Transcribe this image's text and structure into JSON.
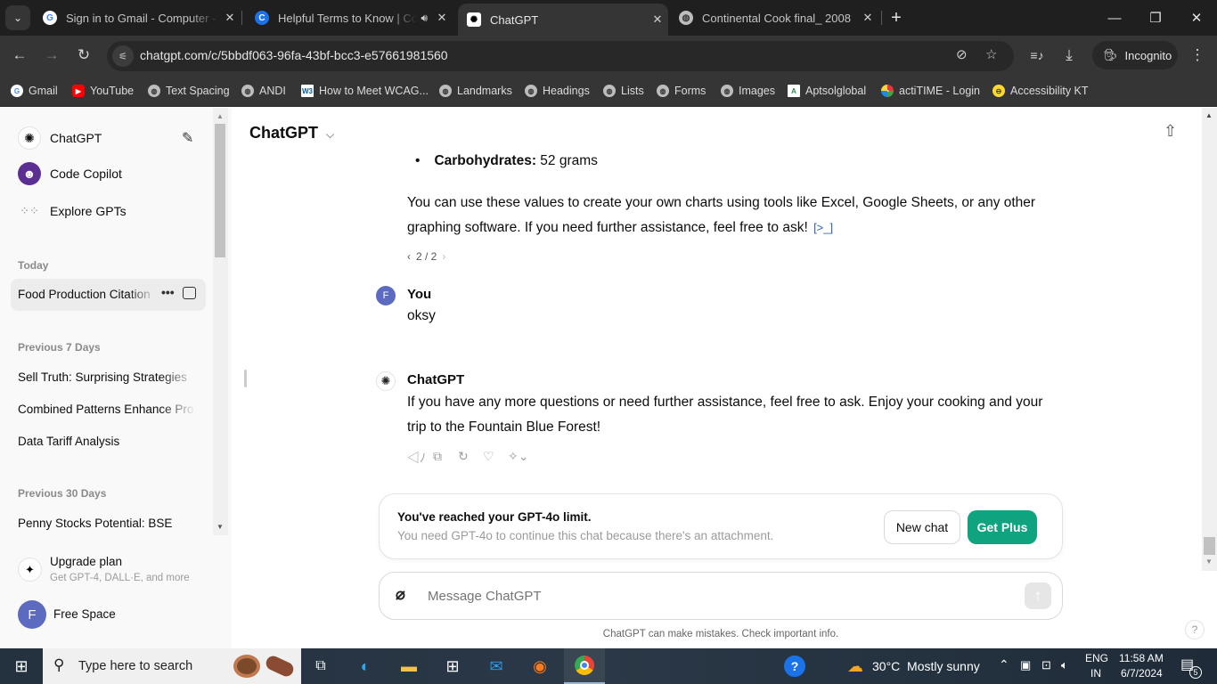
{
  "browser": {
    "tabs": [
      {
        "title": "Sign in to Gmail - Computer - G",
        "favicon": "google-icon",
        "active": false
      },
      {
        "title": "Helpful Terms to Know | Co",
        "favicon": "c-icon",
        "audio": true,
        "active": false
      },
      {
        "title": "ChatGPT",
        "favicon": "chatgpt-icon",
        "active": true
      },
      {
        "title": "Continental Cook final_ 2008",
        "favicon": "globe-icon",
        "active": false
      }
    ],
    "new_tab": "+",
    "url": "chatgpt.com/c/5bbdf063-96fa-43bf-bcc3-e57661981560",
    "incognito_label": "Incognito",
    "bookmarks": [
      {
        "label": "Gmail",
        "icon": "google-icon"
      },
      {
        "label": "YouTube",
        "icon": "youtube-icon"
      },
      {
        "label": "Text Spacing",
        "icon": "globe-icon"
      },
      {
        "label": "ANDI",
        "icon": "globe-icon"
      },
      {
        "label": "How to Meet WCAG...",
        "icon": "w3-icon"
      },
      {
        "label": "Landmarks",
        "icon": "globe-icon"
      },
      {
        "label": "Headings",
        "icon": "globe-icon"
      },
      {
        "label": "Lists",
        "icon": "globe-icon"
      },
      {
        "label": "Forms",
        "icon": "globe-icon"
      },
      {
        "label": "Images",
        "icon": "globe-icon"
      },
      {
        "label": "Aptsolglobal",
        "icon": "aptsol-icon"
      },
      {
        "label": "actiTIME - Login",
        "icon": "actitime-icon"
      },
      {
        "label": "Accessibility KT",
        "icon": "smiley-icon"
      }
    ]
  },
  "sidebar": {
    "top_items": [
      {
        "label": "ChatGPT"
      },
      {
        "label": "Code Copilot"
      },
      {
        "label": "Explore GPTs"
      }
    ],
    "sections": [
      {
        "title": "Today",
        "items": [
          "Food Production Citation"
        ]
      },
      {
        "title": "Previous 7 Days",
        "items": [
          "Sell Truth: Surprising Strategies",
          "Combined Patterns Enhance Pro",
          "Data Tariff Analysis"
        ]
      },
      {
        "title": "Previous 30 Days",
        "items": [
          "Penny Stocks Potential: BSE"
        ]
      }
    ],
    "upgrade": {
      "title": "Upgrade plan",
      "subtitle": "Get GPT-4, DALL·E, and more"
    },
    "user": {
      "initial": "F",
      "name": "Free Space"
    }
  },
  "chat": {
    "model_title": "ChatGPT",
    "bullet": {
      "label": "Carbohydrates:",
      "value": " 52 grams"
    },
    "assistant_msg_1": {
      "line1": "You can use these values to create your own charts using tools like Excel, Google Sheets, or any other",
      "line2": "graphing software. If you need further assistance, feel free to ask!",
      "pager": "2 / 2"
    },
    "user_msg": {
      "author": "You",
      "initial": "F",
      "text": "oksy"
    },
    "assistant_msg_2": {
      "author": "ChatGPT",
      "line1": "If you have any more questions or need further assistance, feel free to ask. Enjoy your cooking and your",
      "line2": "trip to the Fountain Blue Forest!"
    },
    "limit": {
      "title": "You've reached your GPT-4o limit.",
      "subtitle": "You need GPT-4o to continue this chat because there's an attachment.",
      "new_chat": "New chat",
      "get_plus": "Get Plus"
    },
    "composer_placeholder": "Message ChatGPT",
    "disclaimer": "ChatGPT can make mistakes. Check important info.",
    "help": "?"
  },
  "taskbar": {
    "search_placeholder": "Type here to search",
    "weather": "30°C  Mostly sunny",
    "lang1": "ENG",
    "lang2": "IN",
    "time": "11:58 AM",
    "date": "6/7/2024",
    "notif_count": "5"
  },
  "colors": {
    "accent": "#10a37f",
    "avatar": "#5c6bc0"
  }
}
